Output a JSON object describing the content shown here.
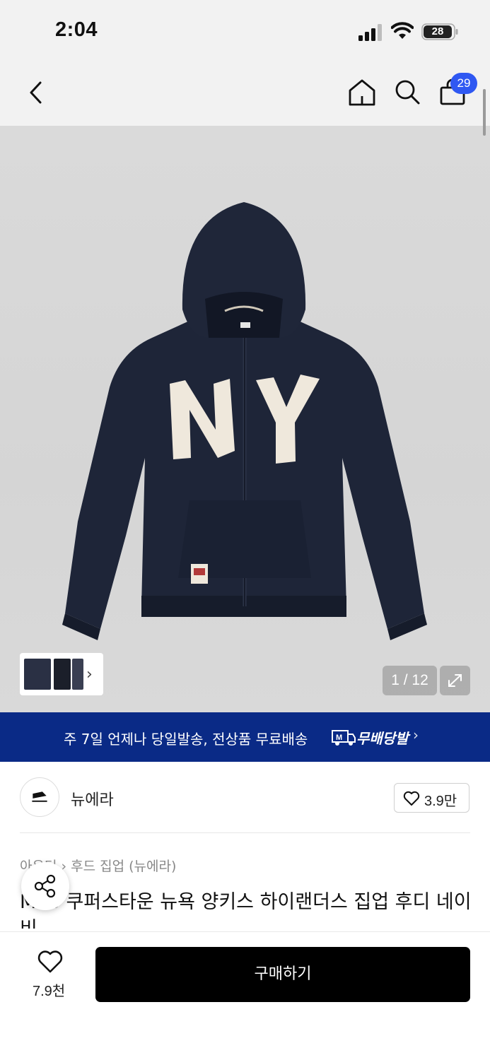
{
  "status_bar": {
    "time": "2:04",
    "battery": "28"
  },
  "nav": {
    "cart_count": "29"
  },
  "gallery": {
    "counter": "1 / 12"
  },
  "promo": {
    "text": "주 7일 언제나 당일발송, 전상품 무료배송",
    "brand": "무배당발",
    "chevron": "›"
  },
  "brand": {
    "name": "뉴에라",
    "like_count": "3.9만"
  },
  "product": {
    "breadcrumb": "아우터 › 후드 집업 (뉴에라)",
    "title": "MLB 쿠퍼스타운 뉴욕 양키스 하이랜더스 집업 후디 네이비"
  },
  "bottom": {
    "wish_count": "7.9천",
    "buy_label": "구매하기"
  },
  "colors": {
    "promo_bg": "#0a2a86",
    "badge": "#2f58f2",
    "hoodie": "#1e2538",
    "patch": "#efe8dc"
  }
}
